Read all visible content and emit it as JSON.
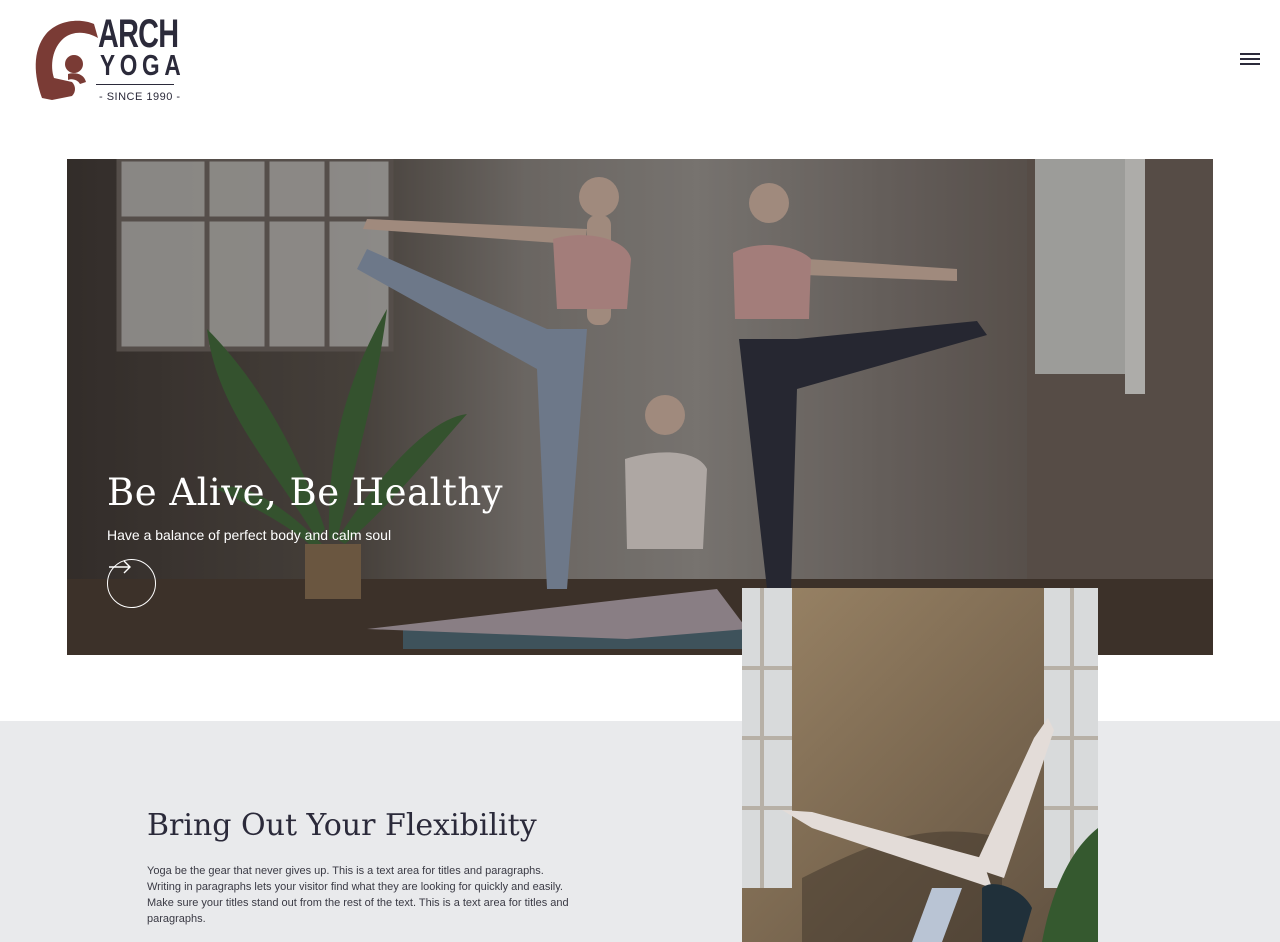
{
  "header": {
    "logo": {
      "line1": "ARCH",
      "line2": "YOGA",
      "tagline": "- SINCE 1990 -",
      "icon": "yoga-pose-logo-icon",
      "color": "#7a3b35"
    },
    "menu_icon": "hamburger-menu-icon"
  },
  "hero": {
    "title": "Be Alive, Be Healthy",
    "subtitle": "Have a balance of perfect body and calm soul",
    "cta_icon": "arrow-right-icon"
  },
  "section": {
    "title": "Bring Out Your Flexibility",
    "body": "Yoga be the gear that never gives up. This is a text area for titles and paragraphs. Writing in paragraphs lets your visitor find what they are looking for quickly and easily. Make sure your titles stand out from the rest of the text. This is a text area for titles and paragraphs."
  },
  "colors": {
    "text_dark": "#2b2a3a",
    "section_bg": "#e9eaec",
    "brand": "#7a3b35"
  }
}
